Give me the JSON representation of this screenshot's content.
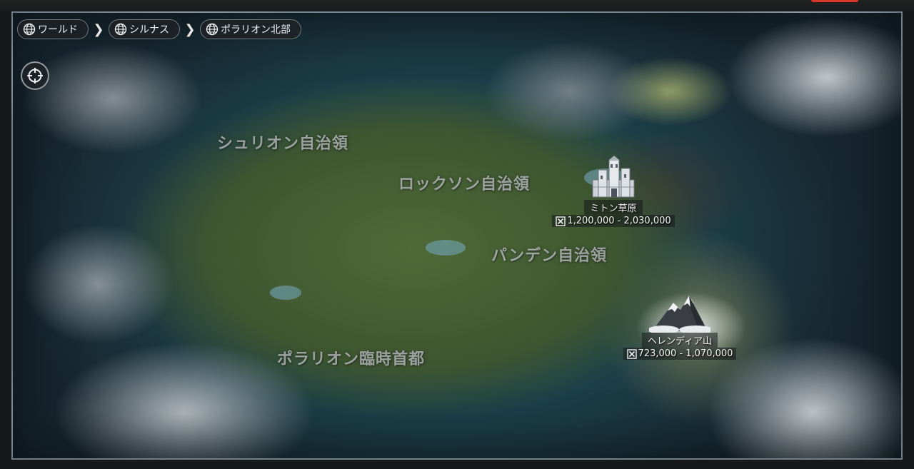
{
  "breadcrumb": {
    "items": [
      {
        "label": "ワールド",
        "icon": "globe-icon"
      },
      {
        "label": "シルナス",
        "icon": "globe-icon"
      },
      {
        "label": "ポラリオン北部",
        "icon": "globe-icon"
      }
    ],
    "separator_icon": "chevron-right-icon"
  },
  "controls": {
    "locate_icon": "crosshair-icon"
  },
  "regions": [
    {
      "label": "シュリオン自治領"
    },
    {
      "label": "ロックソン自治領"
    },
    {
      "label": "パンデン自治領"
    },
    {
      "label": "ポラリオン臨時首都"
    }
  ],
  "points_of_interest": [
    {
      "name": "ミトン草原",
      "range": "1,200,000 - 2,030,000",
      "icon": "castle-icon",
      "range_icon": "power-icon"
    },
    {
      "name": "ヘレンディア山",
      "range": "723,000 - 1,070,000",
      "icon": "mountain-icon",
      "range_icon": "power-icon"
    }
  ],
  "colors": {
    "alert": "#d8372a",
    "frame_border": "#bec8d2",
    "label_text": "#c8ccce"
  }
}
